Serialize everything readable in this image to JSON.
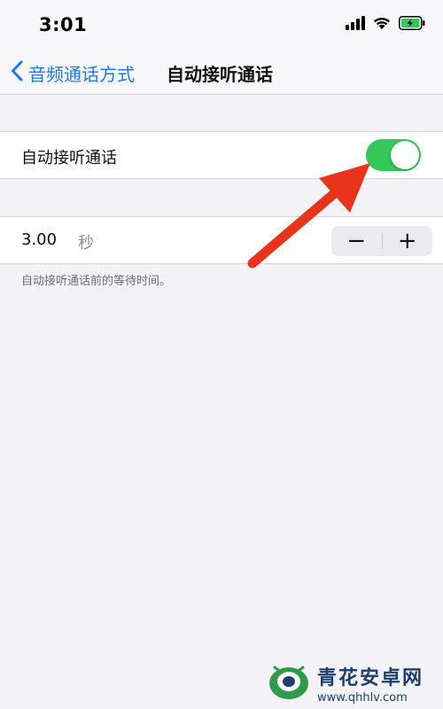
{
  "status_bar": {
    "time": "3:01",
    "icons": [
      "cellular-signal-icon",
      "wifi-icon",
      "battery-charging-icon"
    ]
  },
  "nav": {
    "back_label": "音频通话方式",
    "title": "自动接听通话"
  },
  "auto_answer": {
    "label": "自动接听通话",
    "enabled": true
  },
  "delay": {
    "value": "3.00",
    "unit": "秒",
    "decrement_label": "−",
    "increment_label": "+",
    "footnote": "自动接听通话前的等待时间。"
  },
  "annotation": {
    "arrow_color": "#e8341c"
  },
  "colors": {
    "accent": "#1a7cf5",
    "toggle_on": "#34c759",
    "background": "#f2f2f7"
  },
  "watermark": {
    "title": "青花安卓网",
    "url": "www.qhhlv.com"
  }
}
